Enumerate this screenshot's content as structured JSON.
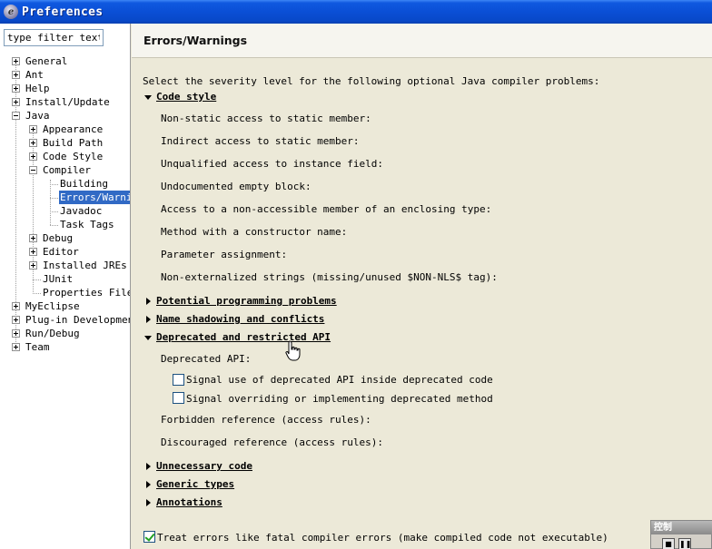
{
  "window": {
    "title": "Preferences"
  },
  "filter": {
    "placeholder": "type filter text",
    "value": "type filter text"
  },
  "tree": {
    "general": "General",
    "ant": "Ant",
    "help": "Help",
    "install_update": "Install/Update",
    "java": "Java",
    "appearance": "Appearance",
    "build_path": "Build Path",
    "code_style": "Code Style",
    "compiler": "Compiler",
    "building": "Building",
    "errors_warnings": "Errors/Warnir",
    "javadoc": "Javadoc",
    "task_tags": "Task Tags",
    "debug": "Debug",
    "editor": "Editor",
    "installed_jres": "Installed JREs",
    "junit": "JUnit",
    "properties_files": "Properties Files",
    "myeclipse": "MyEclipse",
    "plugin_development": "Plug-in Development",
    "run_debug": "Run/Debug",
    "team": "Team"
  },
  "page": {
    "title": "Errors/Warnings",
    "intro": "Select the severity level for the following optional Java compiler problems:"
  },
  "code_style": {
    "title": "Code style",
    "items": [
      "Non-static access to static member:",
      "Indirect access to static member:",
      "Unqualified access to instance field:",
      "Undocumented empty block:",
      "Access to a non-accessible member of an enclosing type:",
      "Method with a constructor name:",
      "Parameter assignment:",
      "Non-externalized strings (missing/unused $NON-NLS$ tag):"
    ]
  },
  "sections": {
    "potential": "Potential programming problems",
    "shadowing": "Name shadowing and conflicts",
    "deprecated": "Deprecated and restricted API",
    "unnecessary": "Unnecessary code",
    "generic": "Generic types",
    "annotations": "Annotations"
  },
  "deprecated": {
    "label": "Deprecated API:",
    "signal_inside": "Signal use of deprecated API inside deprecated code",
    "signal_overriding": "Signal overriding or implementing deprecated method",
    "forbidden": "Forbidden reference (access rules):",
    "discouraged": "Discouraged reference (access rules):"
  },
  "treat_errors": {
    "label": "Treat errors like fatal compiler errors (make compiled code not executable)",
    "checked": true
  },
  "mini_panel": {
    "title": "控制"
  }
}
